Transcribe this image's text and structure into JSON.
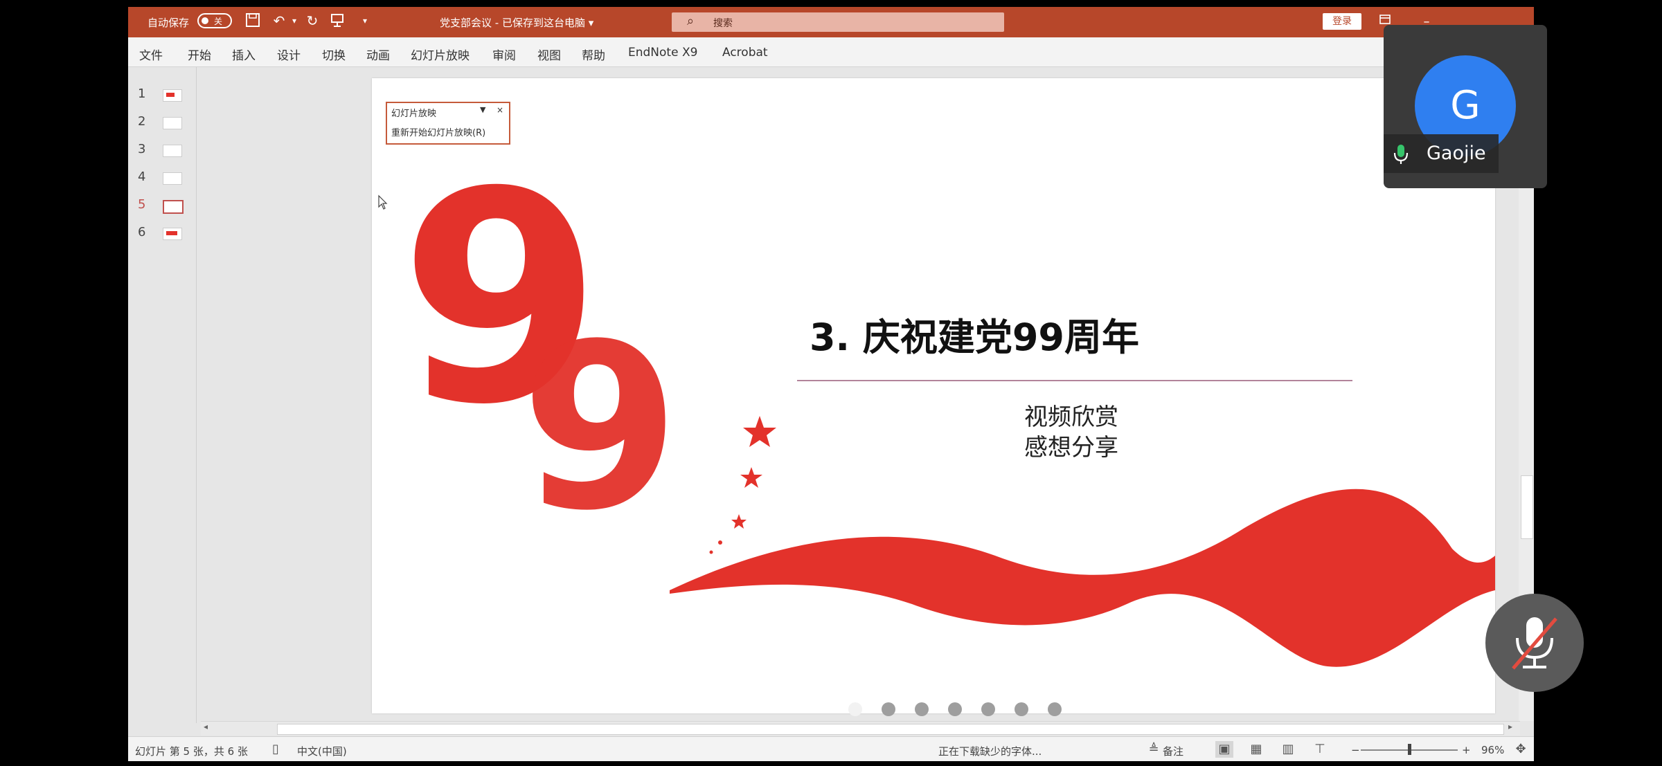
{
  "titlebar": {
    "autosave_label": "自动保存",
    "autosave_state": "关",
    "doc_title": "党支部会议 - 已保存到这台电脑 ▾",
    "search_placeholder": "搜索",
    "login_label": "登录",
    "accent_color": "#b7472a"
  },
  "menu": [
    "文件",
    "开始",
    "插入",
    "设计",
    "切换",
    "动画",
    "幻灯片放映",
    "审阅",
    "视图",
    "帮助",
    "EndNote X9",
    "Acrobat"
  ],
  "thumbnails": {
    "items": [
      "1",
      "2",
      "3",
      "4",
      "5",
      "6"
    ],
    "selected": "5"
  },
  "popup": {
    "title": "幻灯片放映",
    "restart_label": "重新开始幻灯片放映(R)"
  },
  "slide": {
    "title": "3. 庆祝建党99周年",
    "subtitle_line1": "视频欣赏",
    "subtitle_line2": "感想分享",
    "big_number": "99",
    "theme_red": "#e3322b"
  },
  "statusbar": {
    "slide_info": "幻灯片 第 5 张，共 6 张",
    "language": "中文(中国)",
    "loading": "正在下载缺少的字体...",
    "notes_label": "备注",
    "zoom": "96%",
    "zoom_minus": "−",
    "zoom_plus": "+"
  },
  "meeting": {
    "participant_initial": "G",
    "participant_name": "Gaojie",
    "avatar_color": "#2f7ff0"
  }
}
